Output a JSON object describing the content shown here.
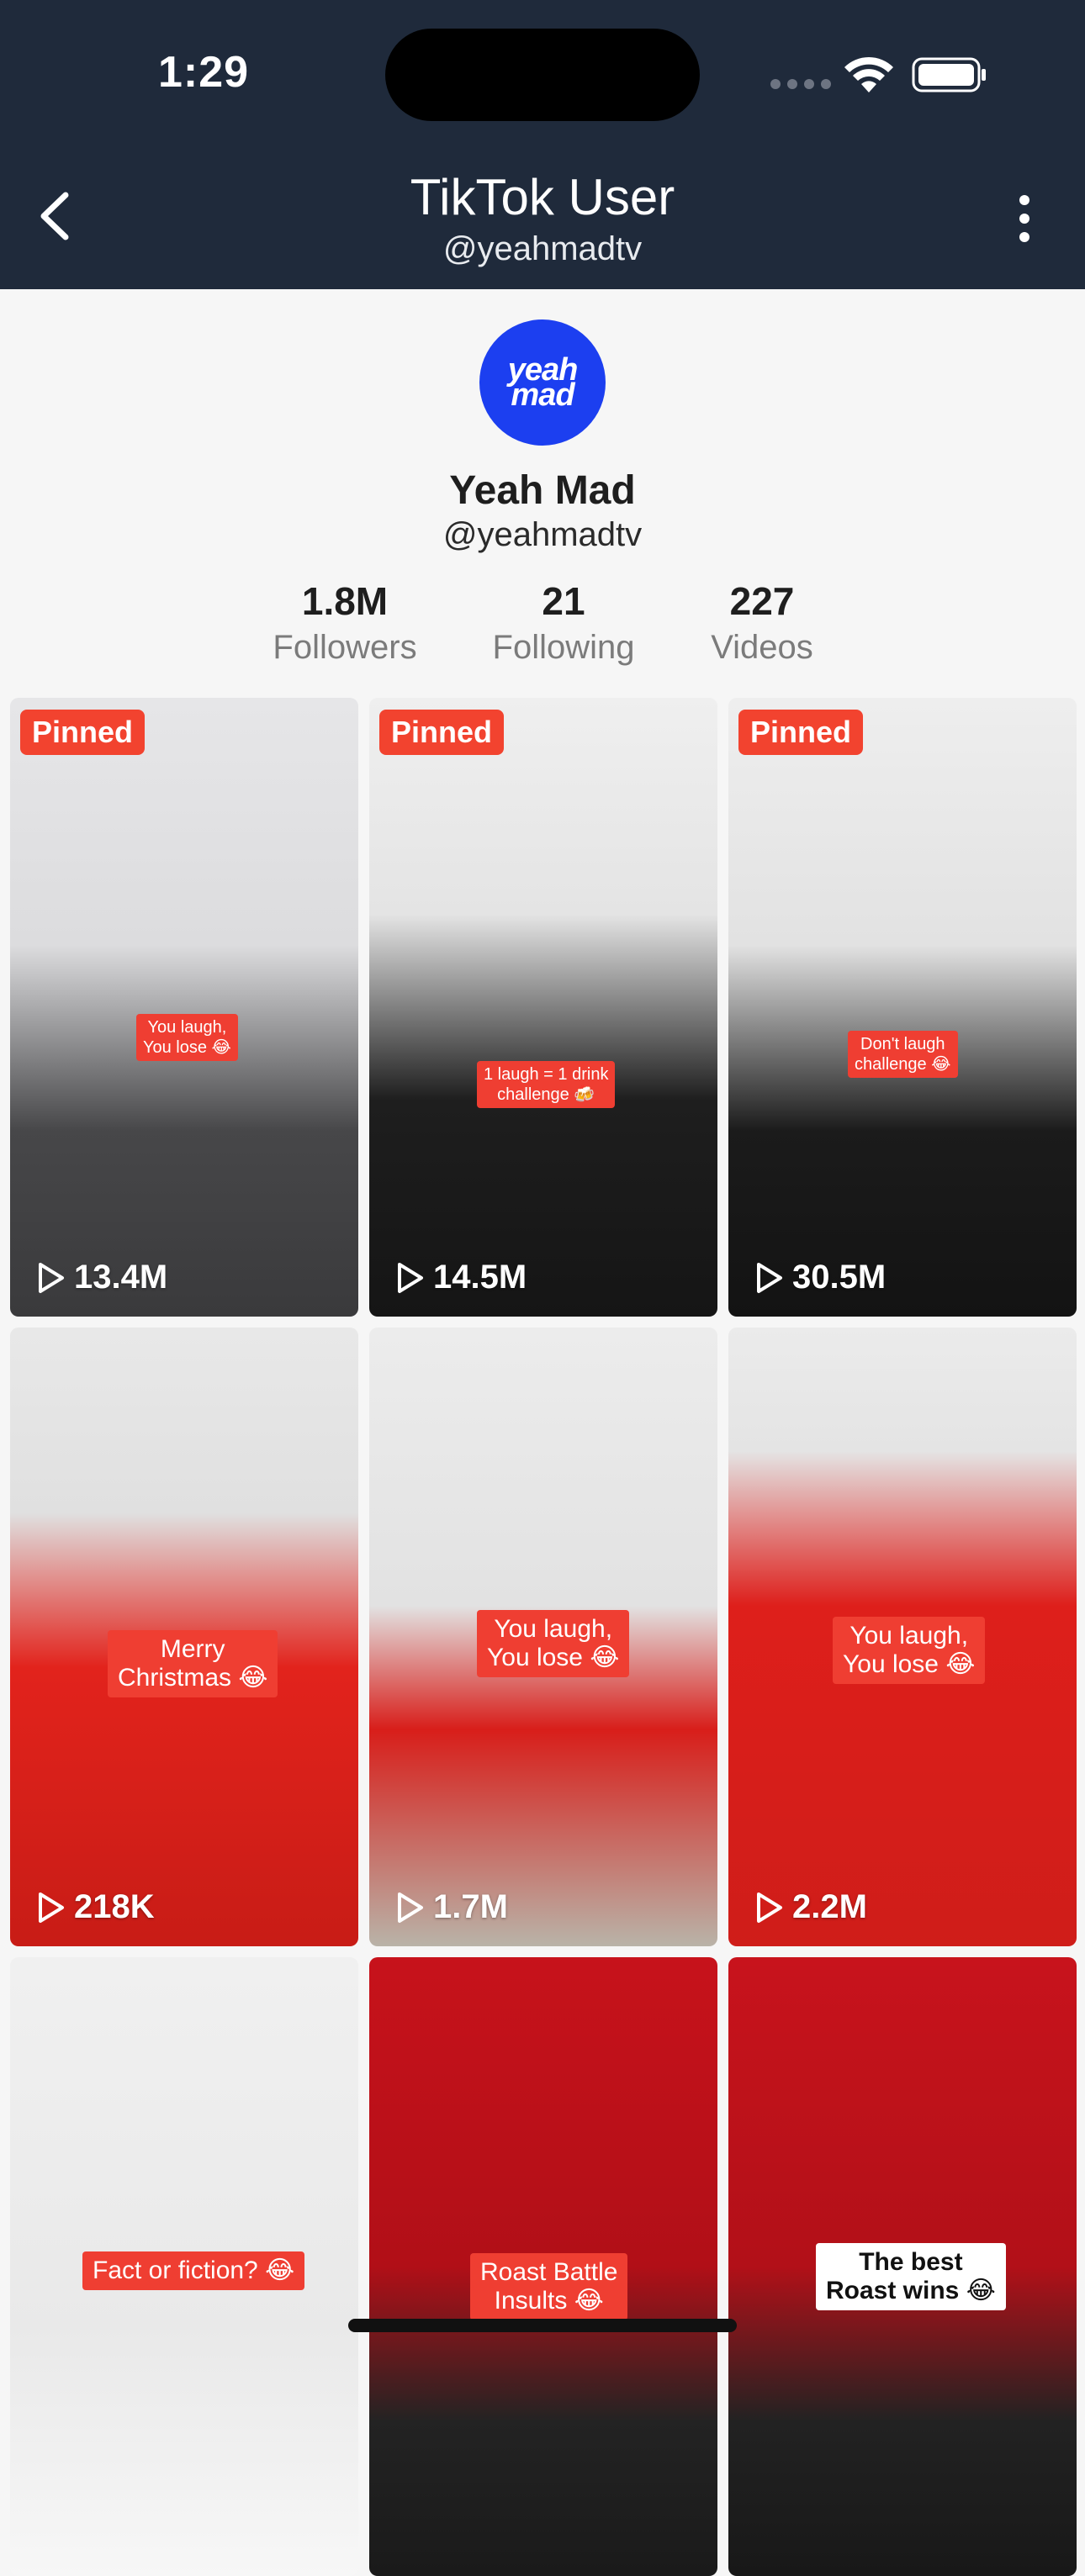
{
  "status_bar": {
    "time": "1:29"
  },
  "header": {
    "title": "TikTok User",
    "subtitle": "@yeahmadtv"
  },
  "profile": {
    "avatar_text": "yeah mad",
    "name": "Yeah Mad",
    "handle": "@yeahmadtv",
    "stats": [
      {
        "value": "1.8M",
        "label": "Followers"
      },
      {
        "value": "21",
        "label": "Following"
      },
      {
        "value": "227",
        "label": "Videos"
      }
    ]
  },
  "videos": [
    {
      "pinned": "Pinned",
      "caption": "You laugh,\nYou lose 😂",
      "views": "13.4M"
    },
    {
      "pinned": "Pinned",
      "caption": "1 laugh = 1 drink\nchallenge 🍻",
      "views": "14.5M"
    },
    {
      "pinned": "Pinned",
      "caption": "Don't laugh\nchallenge 😂",
      "views": "30.5M"
    },
    {
      "caption": "Merry\nChristmas 😂",
      "views": "218K"
    },
    {
      "caption": "You laugh,\nYou lose 😂",
      "views": "1.7M"
    },
    {
      "caption": "You laugh,\nYou lose 😂",
      "views": "2.2M"
    },
    {
      "caption": "Fact or fiction? 😂"
    },
    {
      "caption": "Roast Battle\nInsults 😂"
    },
    {
      "caption": "The best\nRoast wins 😂"
    }
  ],
  "colors": {
    "header_bg": "#1f2a3b",
    "pinned_badge": "#f2432f",
    "avatar_bg": "#1c3ff0"
  }
}
